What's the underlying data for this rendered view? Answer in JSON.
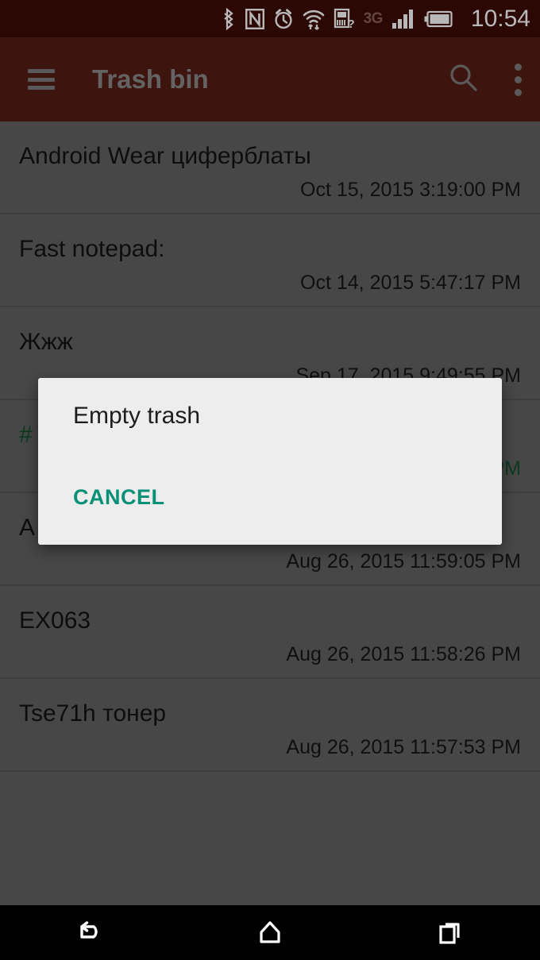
{
  "status_bar": {
    "clock": "10:54",
    "network_type": "3G",
    "icons": [
      {
        "name": "bluetooth-icon",
        "label": "Bluetooth"
      },
      {
        "name": "nfc-icon",
        "label": "NFC"
      },
      {
        "name": "alarm-icon",
        "label": "Alarm set"
      },
      {
        "name": "wifi-icon",
        "label": "Wi-Fi with data activity"
      },
      {
        "name": "sd-card-unknown-icon",
        "label": "SD card unknown"
      },
      {
        "name": "signal-icon",
        "label": "Cellular signal"
      },
      {
        "name": "battery-icon",
        "label": "Battery"
      }
    ],
    "colors": {
      "background": "#3d0c06",
      "text": "#ffffff",
      "dimmed": "#8a5f58"
    }
  },
  "toolbar": {
    "title": "Trash bin",
    "menu_icon": "hamburger-icon",
    "search_icon": "search-icon",
    "overflow_icon": "overflow-menu-icon",
    "colors": {
      "background": "#571d16",
      "title": "#8a8a8a",
      "icon": "#7d7d7d"
    }
  },
  "list": {
    "background_color": "#636363",
    "divider_color": "#575757",
    "selected_text_color": "#14502f",
    "items": [
      {
        "title": "Android Wear циферблаты",
        "date": "Oct 15, 2015 3:19:00 PM",
        "selected": false
      },
      {
        "title": "Fast notepad:",
        "date": "Oct 14, 2015 5:47:17 PM",
        "selected": false
      },
      {
        "title": "Жжж",
        "date": "Sep 17, 2015 9:49:55 PM",
        "selected": false
      },
      {
        "title": "#",
        "date": "PM",
        "selected": true
      },
      {
        "title": "A",
        "date": "Aug 26, 2015 11:59:05 PM",
        "selected": false
      },
      {
        "title": "EX063",
        "date": "Aug 26, 2015 11:58:26 PM",
        "selected": false
      },
      {
        "title": "Tse71h тонер",
        "date": "Aug 26, 2015 11:57:53 PM",
        "selected": false
      }
    ]
  },
  "dialog": {
    "title": "Empty trash",
    "cancel_label": "CANCEL",
    "background_color": "#ededed",
    "accent_color": "#089176"
  },
  "nav_bar": {
    "background_color": "#000000",
    "buttons": [
      {
        "name": "nav-back-button",
        "label": "Back"
      },
      {
        "name": "nav-home-button",
        "label": "Home"
      },
      {
        "name": "nav-recents-button",
        "label": "Recent apps"
      }
    ]
  }
}
